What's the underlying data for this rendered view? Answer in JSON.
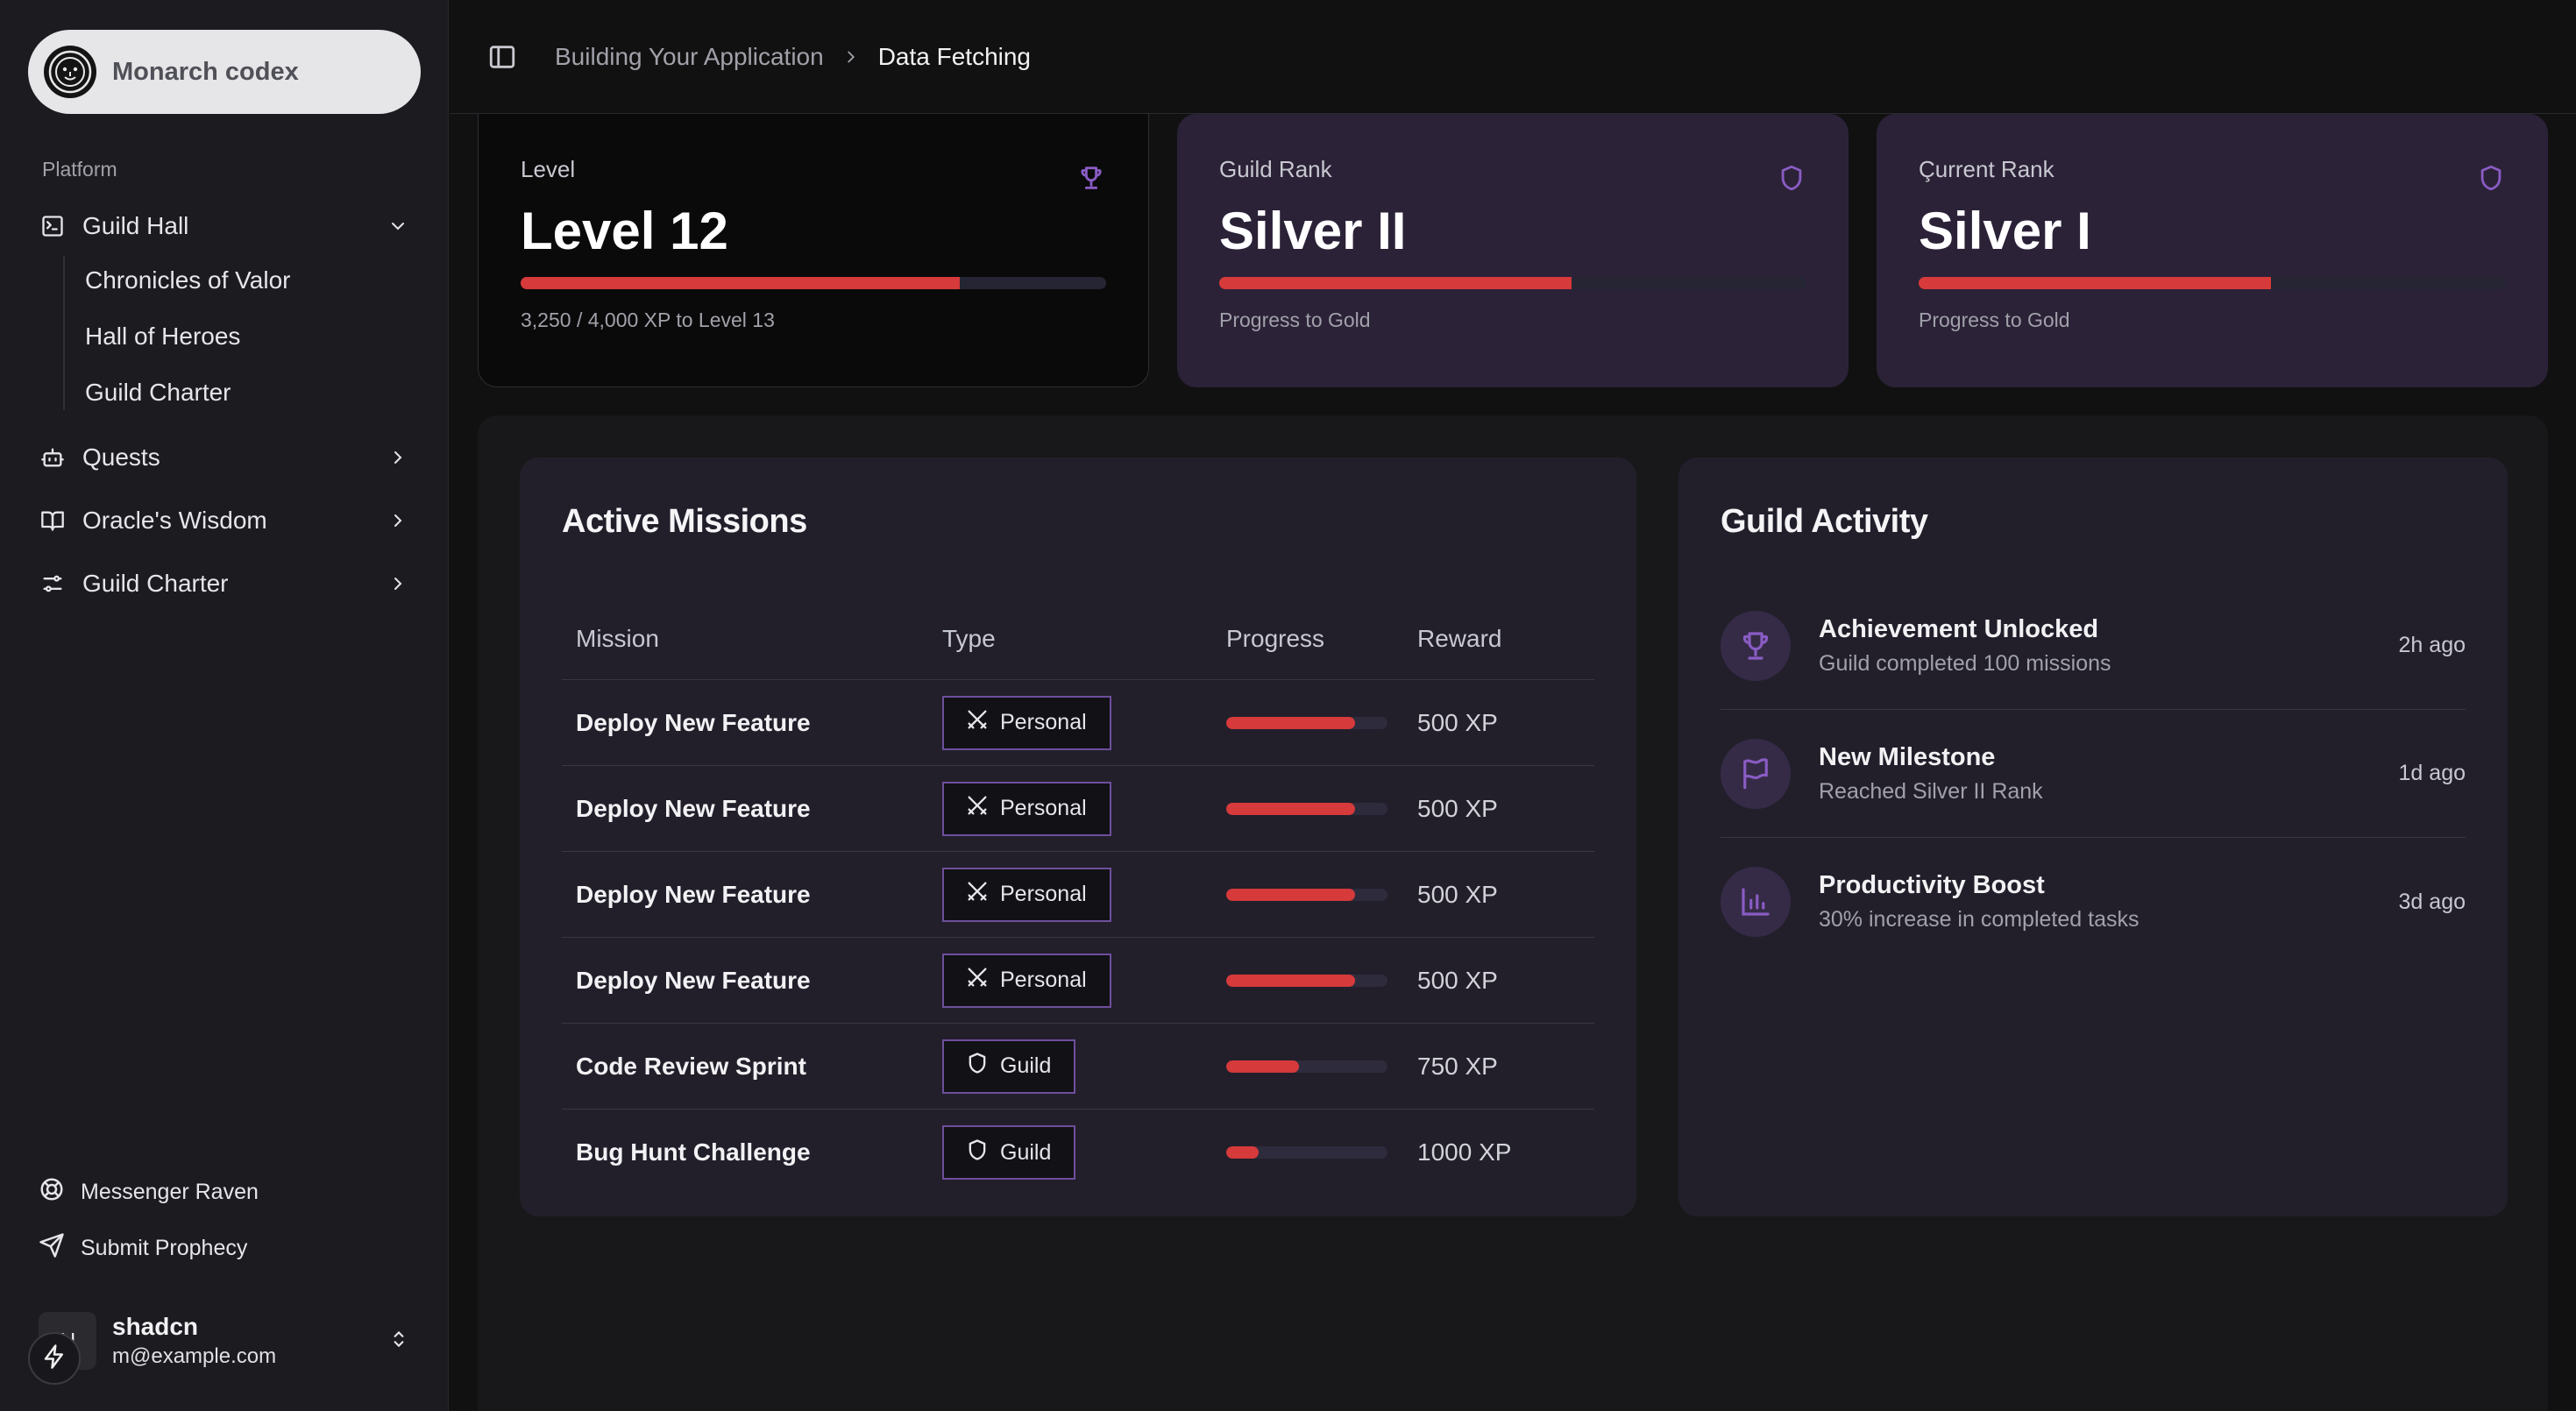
{
  "sidebar": {
    "brand": "Monarch codex",
    "section_label": "Platform",
    "nav": [
      {
        "label": "Guild Hall",
        "icon": "terminal-icon",
        "expanded": true
      },
      {
        "label": "Quests",
        "icon": "bot-icon",
        "expanded": false
      },
      {
        "label": "Oracle's Wisdom",
        "icon": "book-icon",
        "expanded": false
      },
      {
        "label": "Guild Charter",
        "icon": "settings-icon",
        "expanded": false
      }
    ],
    "sub_items": [
      "Chronicles of Valor",
      "Hall of Heroes",
      "Guild Charter"
    ],
    "footer_links": [
      {
        "label": "Messenger Raven",
        "icon": "life-buoy-icon"
      },
      {
        "label": "Submit Prophecy",
        "icon": "send-icon"
      }
    ],
    "user": {
      "initials": "N",
      "name": "shadcn",
      "email": "m@example.com"
    }
  },
  "breadcrumb": {
    "parent": "Building Your Application",
    "current": "Data Fetching"
  },
  "stats": [
    {
      "label": "Level",
      "value": "Level 12",
      "progress": 0.75,
      "sub": "3,250 / 4,000 XP to Level 13",
      "icon": "trophy-icon"
    },
    {
      "label": "Guild Rank",
      "value": "Silver II",
      "progress": 0.6,
      "sub": "Progress to Gold",
      "icon": "shield-icon"
    },
    {
      "label": "Çurrent Rank",
      "value": "Silver I",
      "progress": 0.6,
      "sub": "Progress to Gold",
      "icon": "shield-icon"
    }
  ],
  "missions": {
    "title": "Active Missions",
    "columns": [
      "Mission",
      "Type",
      "Progress",
      "Reward"
    ],
    "rows": [
      {
        "mission": "Deploy New Feature",
        "type": "Personal",
        "progress": 0.8,
        "reward": "500 XP"
      },
      {
        "mission": "Deploy New Feature",
        "type": "Personal",
        "progress": 0.8,
        "reward": "500 XP"
      },
      {
        "mission": "Deploy New Feature",
        "type": "Personal",
        "progress": 0.8,
        "reward": "500 XP"
      },
      {
        "mission": "Deploy New Feature",
        "type": "Personal",
        "progress": 0.8,
        "reward": "500 XP"
      },
      {
        "mission": "Code Review Sprint",
        "type": "Guild",
        "progress": 0.45,
        "reward": "750 XP"
      },
      {
        "mission": "Bug Hunt Challenge",
        "type": "Guild",
        "progress": 0.2,
        "reward": "1000 XP"
      }
    ]
  },
  "activity": {
    "title": "Guild Activity",
    "items": [
      {
        "title": "Achievement Unlocked",
        "sub": "Guild completed 100 missions",
        "time": "2h ago",
        "icon": "trophy-icon"
      },
      {
        "title": "New Milestone",
        "sub": "Reached Silver II Rank",
        "time": "1d ago",
        "icon": "flag-icon"
      },
      {
        "title": "Productivity Boost",
        "sub": "30% increase in completed tasks",
        "time": "3d ago",
        "icon": "bar-chart-icon"
      }
    ]
  },
  "colors": {
    "accent": "#d63a3a",
    "purple": "#8a5cc4",
    "card_purple": "#2b2238"
  }
}
